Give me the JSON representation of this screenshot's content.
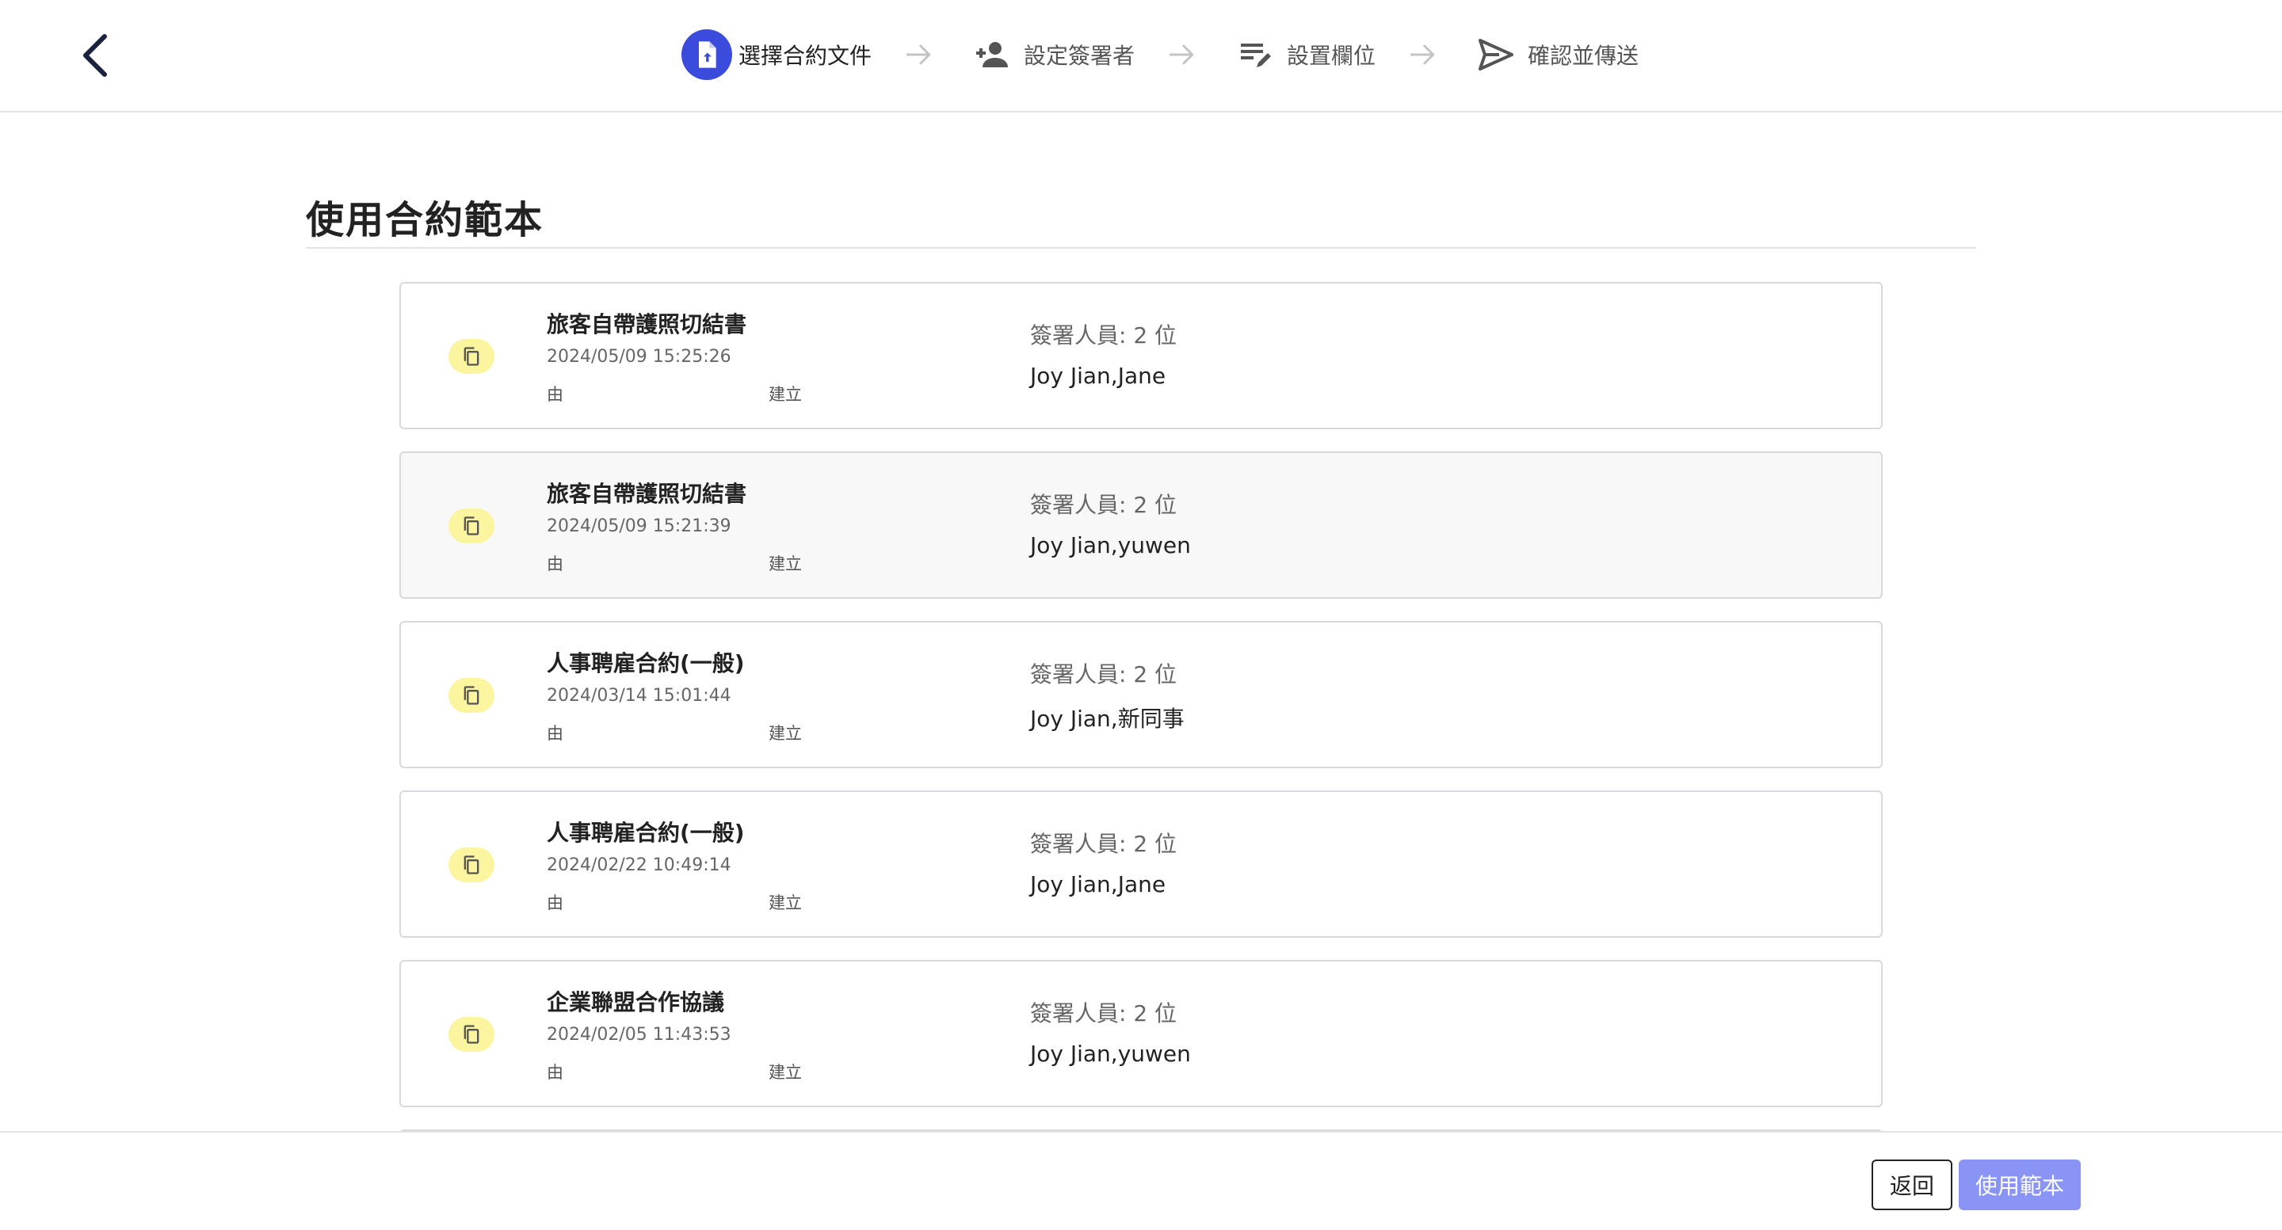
{
  "colors": {
    "accent": "#3b4bdc",
    "icon_badge": "#fbf59f",
    "primary_button": "#8a94f5"
  },
  "header": {
    "back_icon": "chevron-left-icon",
    "steps": [
      {
        "label": "選擇合約文件",
        "icon": "file-upload-icon",
        "active": true
      },
      {
        "label": "設定簽署者",
        "icon": "person-add-icon",
        "active": false
      },
      {
        "label": "設置欄位",
        "icon": "edit-note-icon",
        "active": false
      },
      {
        "label": "確認並傳送",
        "icon": "send-icon",
        "active": false
      }
    ]
  },
  "main": {
    "title": "使用合約範本",
    "templates": [
      {
        "name": "旅客自帶護照切結書",
        "date": "2024/05/09 15:25:26",
        "by": "由",
        "created": "建立",
        "signers_label": "簽署人員: 2 位",
        "signers": "Joy Jian,Jane"
      },
      {
        "name": "旅客自帶護照切結書",
        "date": "2024/05/09 15:21:39",
        "by": "由",
        "created": "建立",
        "signers_label": "簽署人員: 2 位",
        "signers": "Joy Jian,yuwen"
      },
      {
        "name": "人事聘雇合約(一般)",
        "date": "2024/03/14 15:01:44",
        "by": "由",
        "created": "建立",
        "signers_label": "簽署人員: 2 位",
        "signers": "Joy Jian,新同事"
      },
      {
        "name": "人事聘雇合約(一般)",
        "date": "2024/02/22 10:49:14",
        "by": "由",
        "created": "建立",
        "signers_label": "簽署人員: 2 位",
        "signers": "Joy Jian,Jane"
      },
      {
        "name": "企業聯盟合作協議",
        "date": "2024/02/05 11:43:53",
        "by": "由",
        "created": "建立",
        "signers_label": "簽署人員: 2 位",
        "signers": "Joy Jian,yuwen"
      }
    ]
  },
  "footer": {
    "back_label": "返回",
    "use_label": "使用範本"
  }
}
